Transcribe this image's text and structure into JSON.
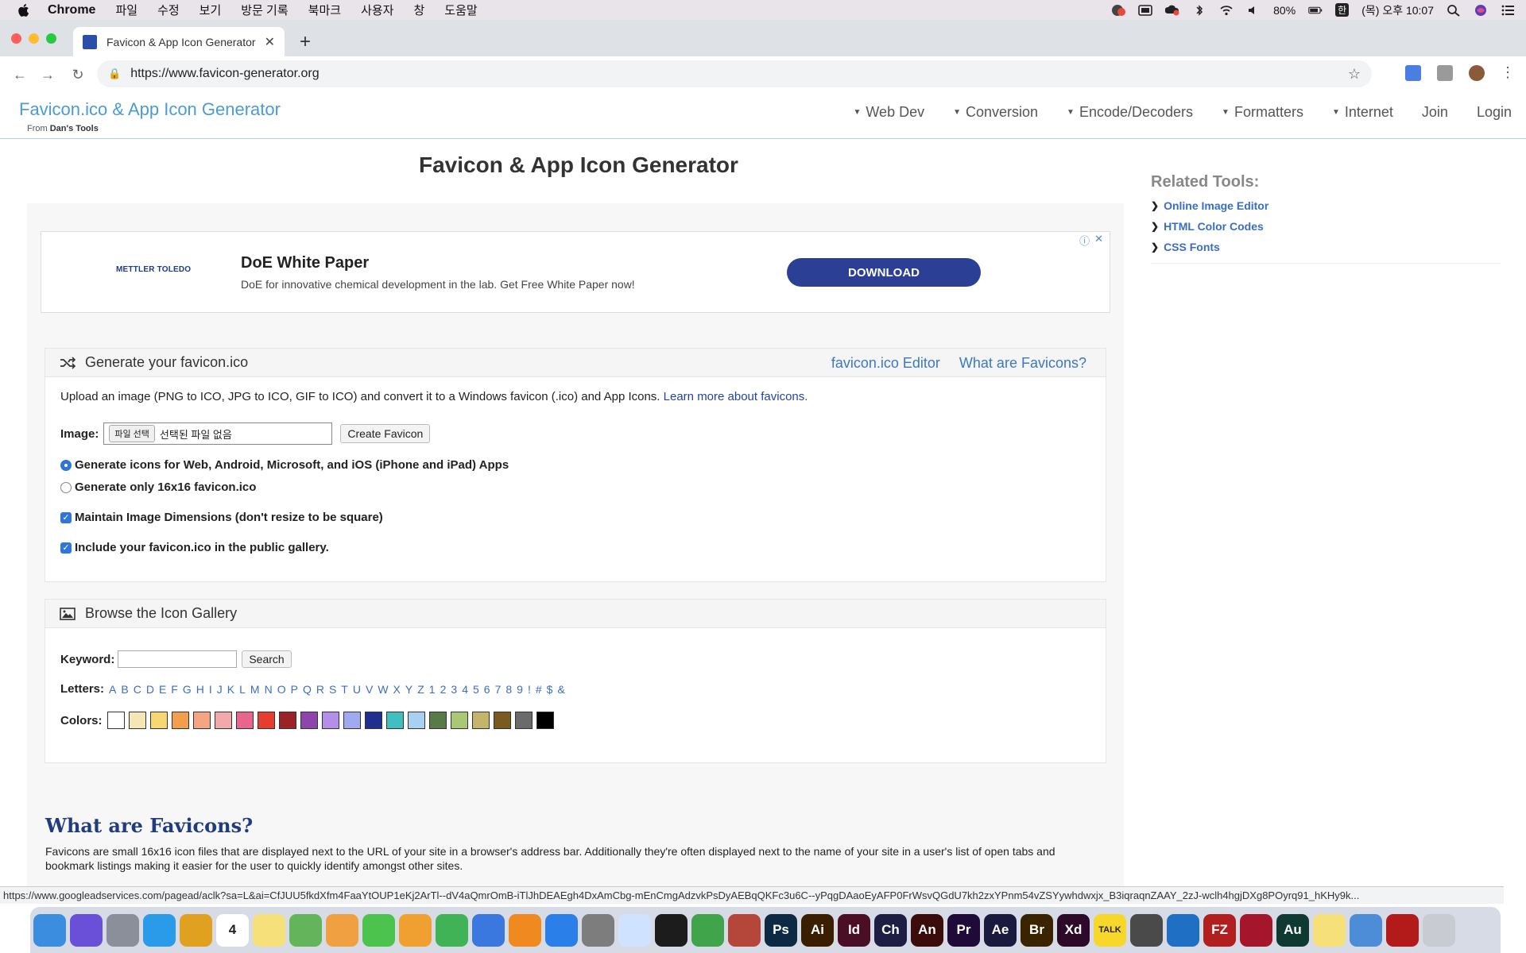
{
  "menubar": {
    "app": "Chrome",
    "items": [
      "파일",
      "수정",
      "보기",
      "방문 기록",
      "북마크",
      "사용자",
      "창",
      "도움말"
    ],
    "battery": "80%",
    "input_lang": "한",
    "clock": "(목) 오후 10:07"
  },
  "tab": {
    "title": "Favicon & App Icon Generator",
    "close": "✕",
    "new": "+"
  },
  "omnibox": {
    "url": "https://www.favicon-generator.org"
  },
  "site": {
    "brand": "Favicon.ico & App Icon Generator",
    "brand_sub_prefix": "From",
    "brand_sub_name": "Dan's Tools",
    "nav": [
      {
        "label": "Web Dev",
        "dropdown": true
      },
      {
        "label": "Conversion",
        "dropdown": true
      },
      {
        "label": "Encode/Decoders",
        "dropdown": true
      },
      {
        "label": "Formatters",
        "dropdown": true
      },
      {
        "label": "Internet",
        "dropdown": true
      },
      {
        "label": "Join",
        "dropdown": false
      },
      {
        "label": "Login",
        "dropdown": false
      }
    ]
  },
  "page": {
    "title": "Favicon & App Icon Generator"
  },
  "ad": {
    "logo": "METTLER TOLEDO",
    "headline": "DoE White Paper",
    "body": "DoE for innovative chemical development in the lab. Get Free White Paper now!",
    "cta": "DOWNLOAD",
    "info": "ⓘ",
    "close": "✕"
  },
  "generate": {
    "title": "Generate your favicon.ico",
    "links": [
      "favicon.ico Editor",
      "What are Favicons?"
    ],
    "description": "Upload an image (PNG to ICO, JPG to ICO, GIF to ICO) and convert it to a Windows favicon (.ico) and App Icons.",
    "learn_more": "Learn more about favicons.",
    "image_label": "Image:",
    "file_button": "파일 선택",
    "file_status": "선택된 파일 없음",
    "create_button": "Create Favicon",
    "option_all": "Generate icons for Web, Android, Microsoft, and iOS (iPhone and iPad) Apps",
    "option_16": "Generate only 16x16 favicon.ico",
    "maintain": "Maintain Image Dimensions (don't resize to be square)",
    "gallery_opt": "Include your favicon.ico in the public gallery."
  },
  "gallery": {
    "title": "Browse the Icon Gallery",
    "keyword_label": "Keyword:",
    "search_button": "Search",
    "letters_label": "Letters:",
    "letters": [
      "A",
      "B",
      "C",
      "D",
      "E",
      "F",
      "G",
      "H",
      "I",
      "J",
      "K",
      "L",
      "M",
      "N",
      "O",
      "P",
      "Q",
      "R",
      "S",
      "T",
      "U",
      "V",
      "W",
      "X",
      "Y",
      "Z",
      "1",
      "2",
      "3",
      "4",
      "5",
      "6",
      "7",
      "8",
      "9",
      "!",
      "#",
      "$",
      "&"
    ],
    "colors_label": "Colors:",
    "colors": [
      "#ffffff",
      "#f5e6b8",
      "#f7d774",
      "#f29e4c",
      "#f4a582",
      "#f2a9a9",
      "#e8668c",
      "#e53e2e",
      "#9b2226",
      "#8e44ad",
      "#b48ee8",
      "#a0aaf0",
      "#1f2f8f",
      "#3fbfbf",
      "#a8d0f0",
      "#587a46",
      "#a9c774",
      "#c5b56a",
      "#7a5a1e",
      "#6b6b6b",
      "#000000"
    ]
  },
  "what": {
    "title": "What are Favicons?",
    "body": "Favicons are small 16x16 icon files that are displayed next to the URL of your site in a browser's address bar. Additionally they're often displayed next to the name of your site in a user's list of open tabs and bookmark listings making it easier for the user to quickly identify amongst other sites."
  },
  "related": {
    "title": "Related Tools:",
    "items": [
      "Online Image Editor",
      "HTML Color Codes",
      "CSS Fonts"
    ]
  },
  "status_url": "https://www.googleadservices.com/pagead/aclk?sa=L&ai=CfJUU5fkdXfm4FaaYtOUP1eKj2ArTl--dV4aQmrOmB-iTlJhDEAEgh4DxAmCbg-mEnCmgAdzvkPsDyAEBqQKFc3u6C--yPqgDAaoEyAFP0FrWsvQGdU7kh2zxYPnm54vZSYywhdwxjx_B3iqraqnZAAY_2zJ-wclh4hgjDXg8POyrq91_hKHy9k...",
  "dock": [
    {
      "name": "finder",
      "color": "#3b8de0",
      "label": ""
    },
    {
      "name": "siri",
      "color": "#6a4fd8",
      "label": ""
    },
    {
      "name": "launchpad",
      "color": "#8a8f9a",
      "label": ""
    },
    {
      "name": "safari",
      "color": "#2a9be8",
      "label": ""
    },
    {
      "name": "chrome",
      "color": "#e0a020",
      "label": ""
    },
    {
      "name": "calendar",
      "color": "#ffffff",
      "label": "4"
    },
    {
      "name": "notes",
      "color": "#f5e07a",
      "label": ""
    },
    {
      "name": "maps",
      "color": "#63b45a",
      "label": ""
    },
    {
      "name": "photos",
      "color": "#f0a040",
      "label": ""
    },
    {
      "name": "messages",
      "color": "#4cc34c",
      "label": ""
    },
    {
      "name": "pages",
      "color": "#f0a030",
      "label": ""
    },
    {
      "name": "numbers",
      "color": "#3fb356",
      "label": ""
    },
    {
      "name": "keynote",
      "color": "#3a78e0",
      "label": ""
    },
    {
      "name": "books",
      "color": "#f08a20",
      "label": ""
    },
    {
      "name": "app-store",
      "color": "#2a7fe8",
      "label": ""
    },
    {
      "name": "system-prefs",
      "color": "#7d7d7d",
      "label": ""
    },
    {
      "name": "affinity",
      "color": "#cfe2ff",
      "label": ""
    },
    {
      "name": "terminal",
      "color": "#1c1c1c",
      "label": ""
    },
    {
      "name": "sync",
      "color": "#3fa44a",
      "label": ""
    },
    {
      "name": "pdf-reader",
      "color": "#b5463a",
      "label": ""
    },
    {
      "name": "photoshop",
      "color": "#0c2a44",
      "label": "Ps"
    },
    {
      "name": "illustrator",
      "color": "#3a1e00",
      "label": "Ai"
    },
    {
      "name": "indesign",
      "color": "#4a0f24",
      "label": "Id"
    },
    {
      "name": "character-animator",
      "color": "#1e1e44",
      "label": "Ch"
    },
    {
      "name": "animate",
      "color": "#3a0c0c",
      "label": "An"
    },
    {
      "name": "premiere",
      "color": "#1f0a3a",
      "label": "Pr"
    },
    {
      "name": "after-effects",
      "color": "#1a1a3e",
      "label": "Ae"
    },
    {
      "name": "bridge",
      "color": "#3a2400",
      "label": "Br"
    },
    {
      "name": "xd",
      "color": "#2e0a2a",
      "label": "Xd"
    },
    {
      "name": "kakaotalk",
      "color": "#f7d82a",
      "label": "TALK"
    },
    {
      "name": "quicktime",
      "color": "#4a4a4a",
      "label": ""
    },
    {
      "name": "vscode",
      "color": "#1f6fc4",
      "label": ""
    },
    {
      "name": "filezilla",
      "color": "#b21f1f",
      "label": "FZ"
    },
    {
      "name": "mendeley",
      "color": "#a5162c",
      "label": ""
    },
    {
      "name": "audition",
      "color": "#0f3a32",
      "label": "Au"
    },
    {
      "name": "stickies",
      "color": "#f5e07a",
      "label": ""
    },
    {
      "name": "preview",
      "color": "#4d8cd6",
      "label": ""
    },
    {
      "name": "acrobat",
      "color": "#b31b1b",
      "label": ""
    },
    {
      "name": "trash",
      "color": "#c8ccd2",
      "label": ""
    }
  ]
}
